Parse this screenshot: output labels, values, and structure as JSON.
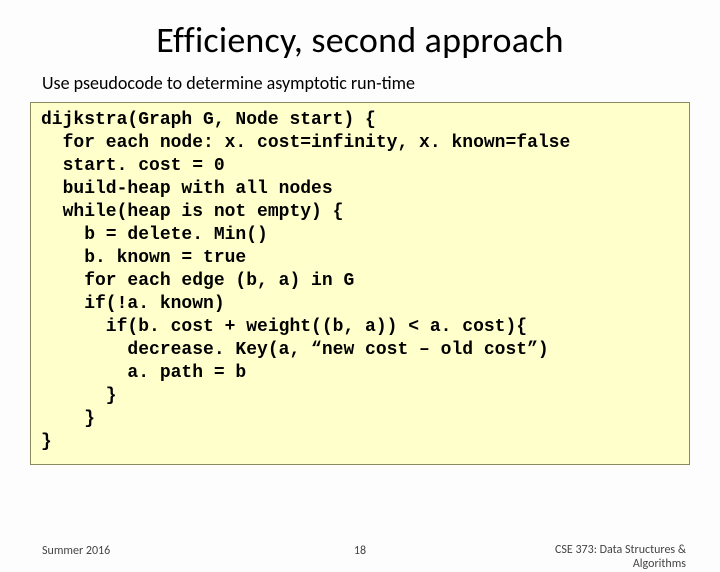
{
  "title": "Efficiency, second approach",
  "subtitle": "Use pseudocode to determine asymptotic run-time",
  "code": "dijkstra(Graph G, Node start) {\n  for each node: x. cost=infinity, x. known=false\n  start. cost = 0\n  build-heap with all nodes\n  while(heap is not empty) {\n    b = delete. Min()\n    b. known = true\n    for each edge (b, a) in G\n    if(!a. known)\n      if(b. cost + weight((b, a)) < a. cost){\n        decrease. Key(a, “new cost – old cost”)\n        a. path = b\n      }\n    }\n}",
  "footer": {
    "left": "Summer 2016",
    "center": "18",
    "right_line1": "CSE 373: Data Structures &",
    "right_line2": "Algorithms"
  }
}
